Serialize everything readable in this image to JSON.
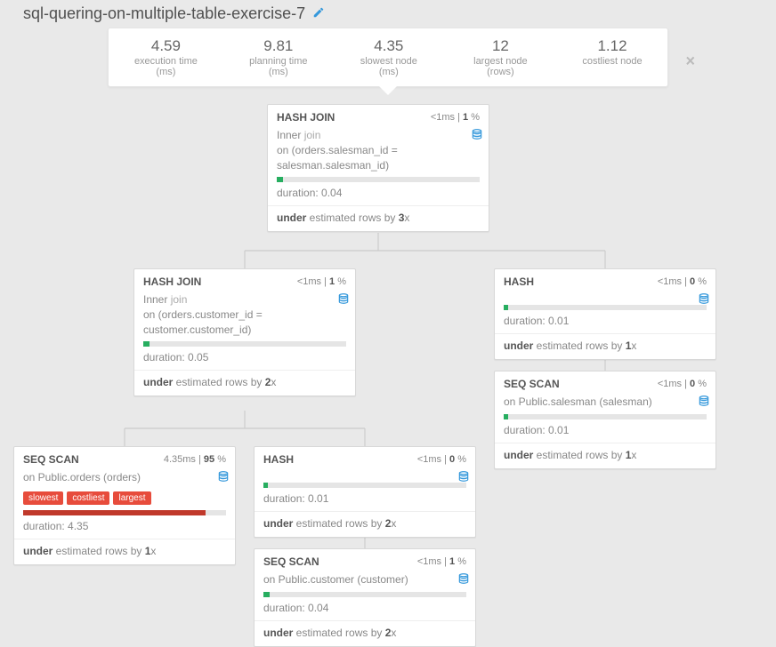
{
  "title": "sql-quering-on-multiple-table-exercise-7",
  "close_label": "×",
  "stats": [
    {
      "value": "4.59",
      "label": "execution time (ms)"
    },
    {
      "value": "9.81",
      "label": "planning time (ms)"
    },
    {
      "value": "4.35",
      "label": "slowest node (ms)"
    },
    {
      "value": "12",
      "label": "largest node (rows)"
    },
    {
      "value": "1.12",
      "label": "costliest node"
    }
  ],
  "nodes": {
    "n1": {
      "name": "HASH JOIN",
      "time": "<1",
      "time_unit": "ms",
      "pct": "1",
      "sub_prefix": "Inner ",
      "sub_kw": "join",
      "sub_line2": "on (orders.salesman_id = salesman.salesman_id)",
      "bar_width": "3%",
      "bar_red": false,
      "dur_label": "duration:",
      "dur_val": "0.04",
      "est_pre": "under",
      "est_mid": " estimated rows by ",
      "est_fac": "3",
      "est_suf": "x"
    },
    "n2": {
      "name": "HASH JOIN",
      "time": "<1",
      "time_unit": "ms",
      "pct": "1",
      "sub_prefix": "Inner ",
      "sub_kw": "join",
      "sub_line2": "on (orders.customer_id = customer.customer_id)",
      "bar_width": "3%",
      "bar_red": false,
      "dur_label": "duration:",
      "dur_val": "0.05",
      "est_pre": "under",
      "est_mid": " estimated rows by ",
      "est_fac": "2",
      "est_suf": "x"
    },
    "n3": {
      "name": "HASH",
      "time": "<1",
      "time_unit": "ms",
      "pct": "0",
      "bar_width": "2%",
      "bar_red": false,
      "dur_label": "duration:",
      "dur_val": "0.01",
      "est_pre": "under",
      "est_mid": " estimated rows by ",
      "est_fac": "1",
      "est_suf": "x"
    },
    "n4": {
      "name": "SEQ SCAN",
      "time": "<1",
      "time_unit": "ms",
      "pct": "0",
      "sub_line1": "on Public.salesman (salesman)",
      "bar_width": "2%",
      "bar_red": false,
      "dur_label": "duration:",
      "dur_val": "0.01",
      "est_pre": "under",
      "est_mid": " estimated rows by ",
      "est_fac": "1",
      "est_suf": "x"
    },
    "n5": {
      "name": "SEQ SCAN",
      "time": "4.35",
      "time_unit": "ms",
      "pct": "95",
      "sub_line1": "on Public.orders (orders)",
      "tags": [
        "slowest",
        "costliest",
        "largest"
      ],
      "bar_width": "90%",
      "bar_red": true,
      "dur_label": "duration:",
      "dur_val": "4.35",
      "est_pre": "under",
      "est_mid": " estimated rows by ",
      "est_fac": "1",
      "est_suf": "x"
    },
    "n6": {
      "name": "HASH",
      "time": "<1",
      "time_unit": "ms",
      "pct": "0",
      "bar_width": "2%",
      "bar_red": false,
      "dur_label": "duration:",
      "dur_val": "0.01",
      "est_pre": "under",
      "est_mid": " estimated rows by ",
      "est_fac": "2",
      "est_suf": "x"
    },
    "n7": {
      "name": "SEQ SCAN",
      "time": "<1",
      "time_unit": "ms",
      "pct": "1",
      "sub_line1": "on Public.customer (customer)",
      "bar_width": "3%",
      "bar_red": false,
      "dur_label": "duration:",
      "dur_val": "0.04",
      "est_pre": "under",
      "est_mid": " estimated rows by ",
      "est_fac": "2",
      "est_suf": "x"
    }
  }
}
